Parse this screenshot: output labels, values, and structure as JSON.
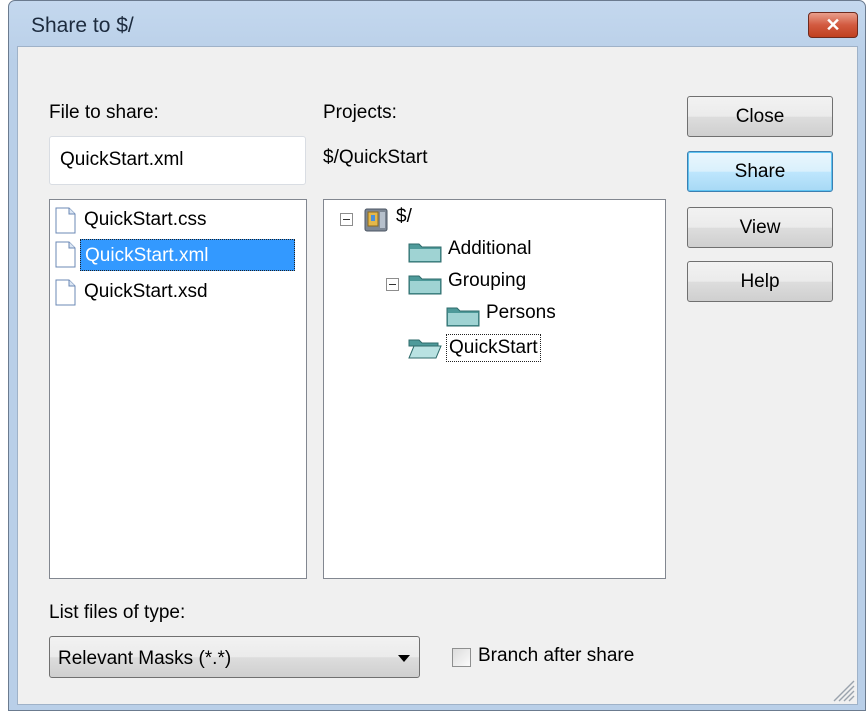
{
  "window": {
    "title": "Share to $/",
    "close_glyph": "✕"
  },
  "file_to_share": {
    "label": "File to share:",
    "value": "QuickStart.xml"
  },
  "projects": {
    "label": "Projects:",
    "path": "$/QuickStart"
  },
  "files": [
    {
      "name": "QuickStart.css",
      "selected": false
    },
    {
      "name": "QuickStart.xml",
      "selected": true
    },
    {
      "name": "QuickStart.xsd",
      "selected": false
    }
  ],
  "tree": {
    "root": "$/",
    "nodes": [
      "Additional",
      "Grouping",
      "Persons",
      "QuickStart"
    ]
  },
  "buttons": {
    "close": "Close",
    "share": "Share",
    "view": "View",
    "help": "Help"
  },
  "file_type": {
    "label": "List files of type:",
    "value": "Relevant Masks (*.*)"
  },
  "branch_after_share": {
    "label": "Branch after share",
    "checked": false
  },
  "colors": {
    "selection": "#3399ff",
    "title_close": "#c0401f"
  }
}
